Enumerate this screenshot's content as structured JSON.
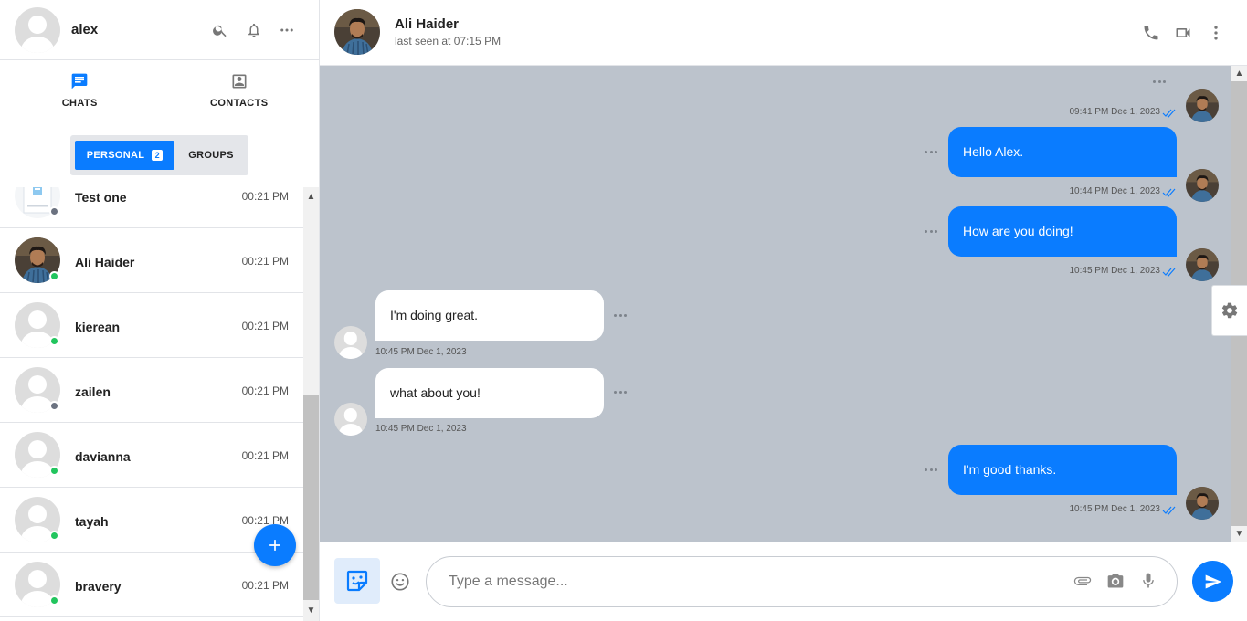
{
  "user": {
    "name": "alex"
  },
  "tabs": [
    {
      "label": "CHATS",
      "icon": "chat-icon"
    },
    {
      "label": "CONTACTS",
      "icon": "contacts-icon"
    }
  ],
  "segments": {
    "personal": "PERSONAL",
    "personal_count": "2",
    "groups": "GROUPS"
  },
  "chats": [
    {
      "name": "Test one",
      "time": "00:21 PM",
      "status": "offline"
    },
    {
      "name": "Ali Haider",
      "time": "00:21 PM",
      "status": "online"
    },
    {
      "name": "kierean",
      "time": "00:21 PM",
      "status": "online"
    },
    {
      "name": "zailen",
      "time": "00:21 PM",
      "status": "offline"
    },
    {
      "name": "davianna",
      "time": "00:21 PM",
      "status": "online"
    },
    {
      "name": "tayah",
      "time": "00:21 PM",
      "status": "online"
    },
    {
      "name": "bravery",
      "time": "00:21 PM",
      "status": "online"
    }
  ],
  "status_colors": {
    "online": "#22c55e",
    "offline": "#6b7280"
  },
  "contact": {
    "name": "Ali Haider",
    "last_seen": "last seen at 07:15 PM"
  },
  "messages": [
    {
      "dir": "out",
      "text": "",
      "time": "09:41 PM Dec 1, 2023"
    },
    {
      "dir": "out",
      "text": "Hello Alex.",
      "time": "10:44 PM Dec 1, 2023"
    },
    {
      "dir": "out",
      "text": "How are you doing!",
      "time": "10:45 PM Dec 1, 2023"
    },
    {
      "dir": "in",
      "text": "I'm doing great.",
      "time": "10:45 PM Dec 1, 2023"
    },
    {
      "dir": "in",
      "text": "what about you!",
      "time": "10:45 PM Dec 1, 2023"
    },
    {
      "dir": "out",
      "text": "I'm good thanks.",
      "time": "10:45 PM Dec 1, 2023"
    }
  ],
  "composer": {
    "placeholder": "Type a message..."
  },
  "colors": {
    "accent": "#0a7cff",
    "chat_bg": "#bcc3cc"
  }
}
